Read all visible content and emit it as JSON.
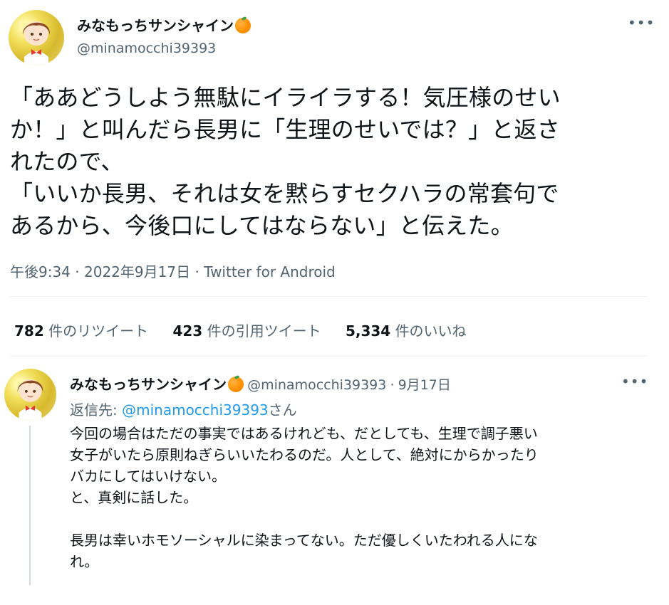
{
  "main_tweet": {
    "display_name": "みなもっちサンシャイン",
    "name_emoji": "orange-emoji",
    "handle": "@minamocchi39393",
    "more_icon": "more-horizontal-icon",
    "text": "「ああどうしよう無駄にイライラする！気圧様のせい\nか！」と叫んだら長男に「生理のせいでは？」と返さ\nれたので、\n「いいか長男、それは女を黙らすセクハラの常套句で\nあるから、今後口にしてはならない」と伝えた。",
    "time": "午後9:34",
    "separator": "·",
    "date": "2022年9月17日",
    "source": "Twitter for Android"
  },
  "stats": {
    "retweets": {
      "count": "782",
      "label": "件のリツイート"
    },
    "quotes": {
      "count": "423",
      "label": "件の引用ツイート"
    },
    "likes": {
      "count": "5,334",
      "label": "件のいいね"
    }
  },
  "reply_tweet": {
    "display_name": "みなもっちサンシャイン",
    "handle": "@minamocchi39393",
    "separator": "·",
    "date": "9月17日",
    "reply_to_prefix": "返信先: ",
    "reply_to_handle": "@minamocchi39393",
    "reply_to_suffix": "さん",
    "text": "今回の場合はただの事実ではあるけれども、だとしても、生理で調子悪い\n女子がいたら原則ねぎらいいたわるのだ。人として、絶対にからかったり\nバカにしてはいけない。\nと、真剣に話した。\n\n長男は幸いホモソーシャルに染まってない。ただ優しくいたわれる人にな\nれ。"
  },
  "colors": {
    "link": "#1d9bf0",
    "secondary_text": "#536471",
    "divider": "#eff3f4"
  }
}
